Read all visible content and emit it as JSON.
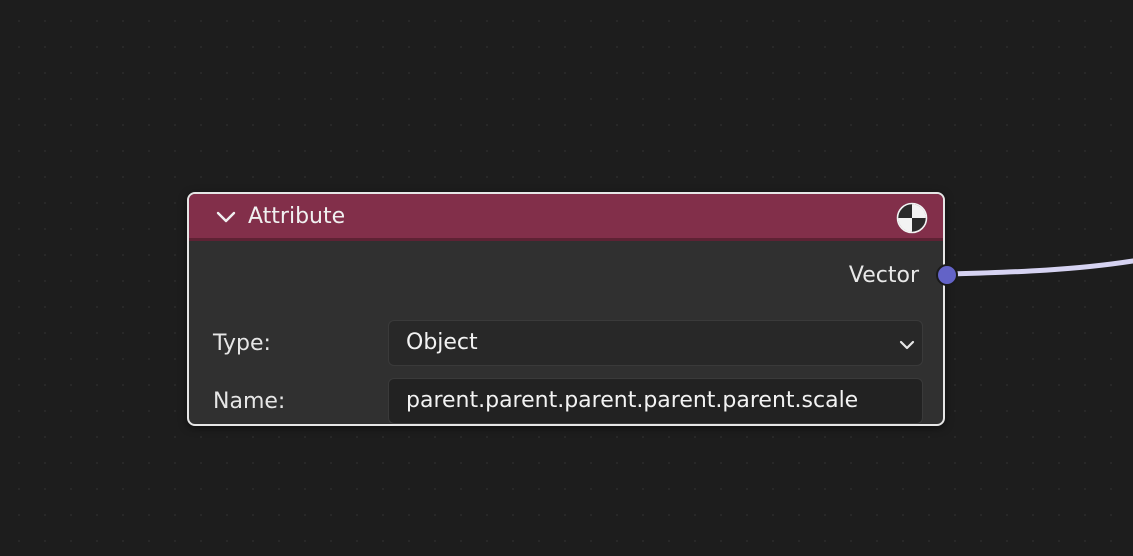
{
  "node": {
    "title": "Attribute",
    "header_color": "#822f4a",
    "collapse_icon": "chevron-down-icon",
    "preview_icon": "material-preview-icon",
    "output": {
      "label": "Vector",
      "socket_color": "#6363c7"
    },
    "fields": {
      "type_label": "Type:",
      "type_value": "Object",
      "name_label": "Name:",
      "name_value": "parent.parent.parent.parent.parent.scale"
    }
  },
  "link": {
    "color": "#d6d3f2"
  }
}
